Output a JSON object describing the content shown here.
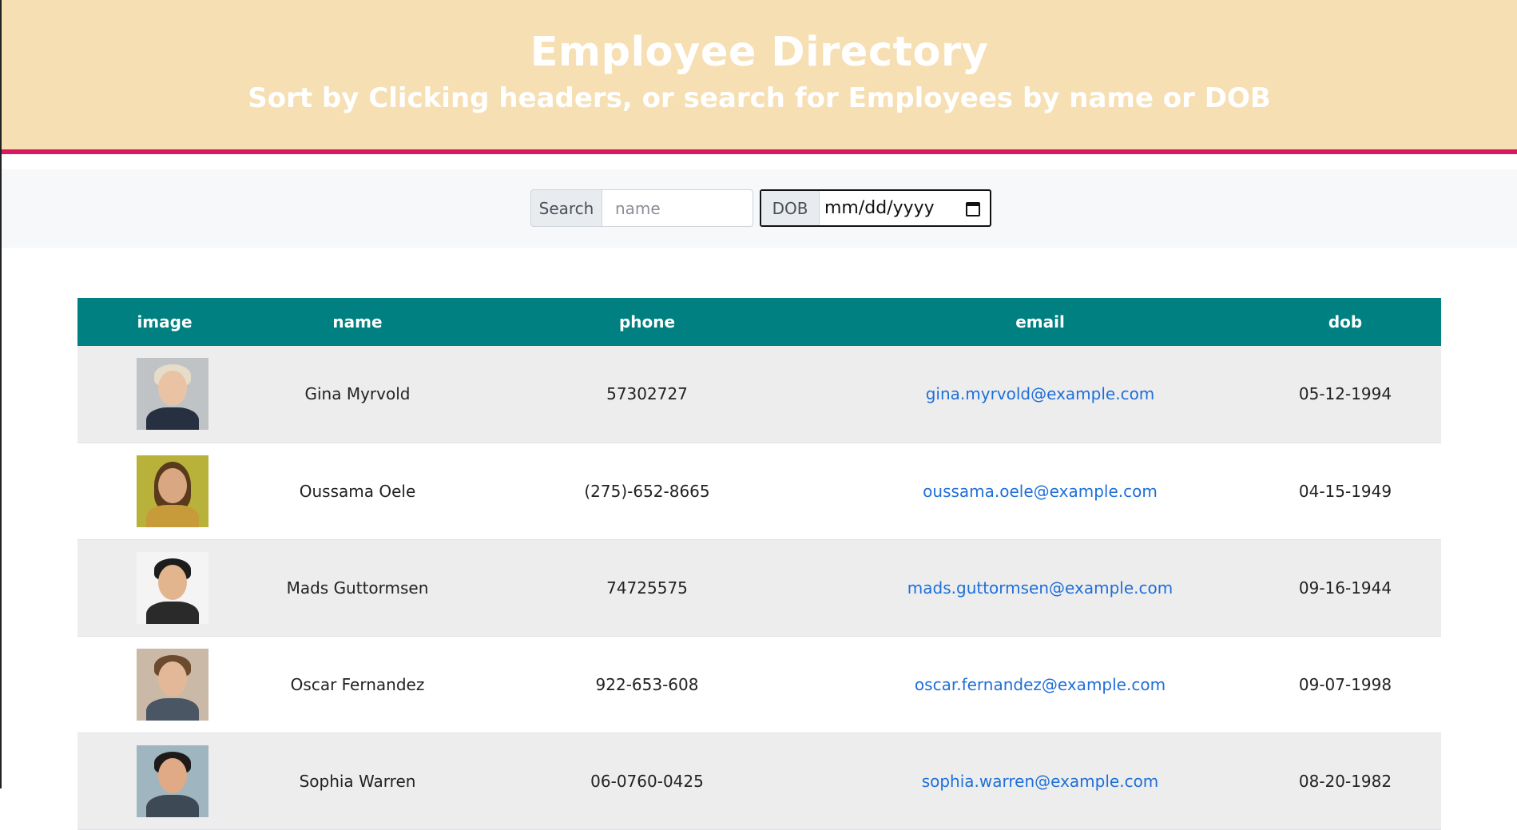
{
  "header": {
    "title": "Employee Directory",
    "subtitle": "Sort by Clicking headers, or search for Employees by name or DOB"
  },
  "search": {
    "label": "Search",
    "placeholder": "name",
    "dob_label": "DOB",
    "dob_value": "mm/dd/yyyy"
  },
  "table": {
    "columns": [
      "image",
      "name",
      "phone",
      "email",
      "dob"
    ],
    "rows": [
      {
        "name": "Gina Myrvold",
        "phone": "57302727",
        "email": "gina.myrvold@example.com",
        "dob": "05-12-1994"
      },
      {
        "name": "Oussama Oele",
        "phone": "(275)-652-8665",
        "email": "oussama.oele@example.com",
        "dob": "04-15-1949"
      },
      {
        "name": "Mads Guttormsen",
        "phone": "74725575",
        "email": "mads.guttormsen@example.com",
        "dob": "09-16-1944"
      },
      {
        "name": "Oscar Fernandez",
        "phone": "922-653-608",
        "email": "oscar.fernandez@example.com",
        "dob": "09-07-1998"
      },
      {
        "name": "Sophia Warren",
        "phone": "06-0760-0425",
        "email": "sophia.warren@example.com",
        "dob": "08-20-1982"
      }
    ]
  },
  "colors": {
    "header_bg": "#f6dfb3",
    "header_border": "#d81b60",
    "table_header_bg": "#008080",
    "link": "#1e6fd9"
  }
}
